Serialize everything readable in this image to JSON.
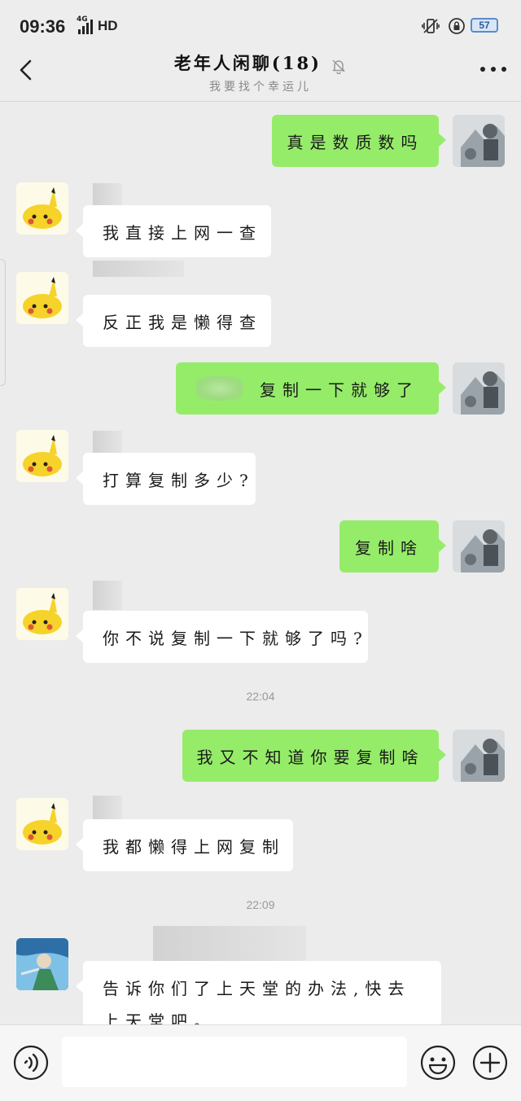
{
  "status_bar": {
    "time": "09:36",
    "network": "4G",
    "hd": "HD",
    "battery": "57"
  },
  "header": {
    "title": "老年人闲聊(18)",
    "subtitle": "我要找个幸运儿"
  },
  "messages": [
    {
      "side": "out",
      "text": "真是数质数吗"
    },
    {
      "side": "in",
      "text": "我直接上网一查"
    },
    {
      "side": "in",
      "text": "反正我是懒得查"
    },
    {
      "side": "out",
      "text": "复制一下就够了"
    },
    {
      "side": "in",
      "text": "打算复制多少?"
    },
    {
      "side": "out",
      "text": "复制啥"
    },
    {
      "side": "in",
      "text": "你不说复制一下就够了吗?"
    },
    {
      "side": "out",
      "text": "我又不知道你要复制啥"
    },
    {
      "side": "in",
      "text": "我都懒得上网复制"
    },
    {
      "side": "in",
      "text": "告诉你们了上天堂的办法,快去上天堂吧。"
    }
  ],
  "timestamps": [
    "22:04",
    "22:09"
  ],
  "icons": {
    "back": "back-arrow-icon",
    "mute": "bell-muted-icon",
    "more": "more-dots-icon",
    "voice": "voice-icon",
    "emoji": "emoji-icon",
    "plus": "plus-icon"
  },
  "colors": {
    "outgoing_bubble": "#95ec69",
    "incoming_bubble": "#ffffff",
    "chat_bg": "#ececec"
  },
  "input": {
    "value": "",
    "placeholder": ""
  }
}
